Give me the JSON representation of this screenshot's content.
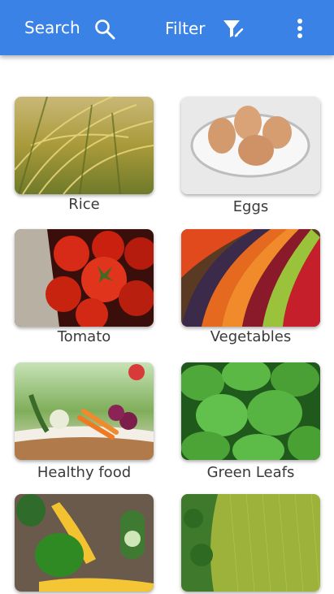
{
  "toolbar": {
    "search_label": "Search",
    "filter_label": "Filter",
    "accent_color": "#3b82e6"
  },
  "categories": [
    {
      "label": "Rice",
      "image": "rice-photo"
    },
    {
      "label": "Eggs",
      "image": "eggs-photo"
    },
    {
      "label": "Tomato",
      "image": "tomato-photo"
    },
    {
      "label": "Vegetables",
      "image": "vegetables-photo"
    },
    {
      "label": "Healthy food",
      "image": "healthy-food-photo"
    },
    {
      "label": "Green Leafs",
      "image": "green-leafs-photo"
    },
    {
      "label": "",
      "image": "corn-peppers-photo"
    },
    {
      "label": "",
      "image": "green-field-photo"
    }
  ]
}
